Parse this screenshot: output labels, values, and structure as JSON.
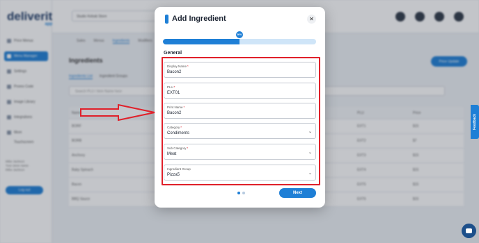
{
  "app": {
    "logo": "deliverit",
    "logo_sub": "app"
  },
  "sidebar": {
    "items": [
      {
        "label": "Price Menus",
        "icon": "menu-icon"
      },
      {
        "label": "Menu Manager",
        "icon": "list-icon",
        "active": true
      },
      {
        "label": "Settings",
        "icon": "gear-icon"
      },
      {
        "label": "Promo Code",
        "icon": "tag-icon"
      },
      {
        "label": "Image Library",
        "icon": "image-icon"
      },
      {
        "label": "Integrations",
        "icon": "plug-icon"
      },
      {
        "label": "More",
        "icon": "dots-icon"
      },
      {
        "label": "Touchscreen",
        "icon": "screen-icon"
      }
    ],
    "user_lines": [
      "Mike Jackson",
      "Your store name",
      "Mike Jackson"
    ],
    "action_button": "Log out"
  },
  "topbar": {
    "store": "Studio Kebab Store"
  },
  "tabs": [
    "Sales",
    "Menus",
    "Ingredients",
    "Modifiers"
  ],
  "page": {
    "title": "Ingredients",
    "update_button": "Price Update",
    "subtabs": [
      "Ingredients List",
      "Ingredient Groups"
    ],
    "search_placeholder": "Search PLU / Item Name here"
  },
  "table": {
    "headers": [
      "Name",
      "PLU",
      "Price"
    ],
    "rows": [
      [
        "BORF",
        "EXT1",
        "$15"
      ],
      [
        "BORB",
        "EXT2",
        "$7"
      ],
      [
        "Anchovy",
        "EXT3",
        "$15"
      ],
      [
        "Baby Spinach",
        "EXT4",
        "$15"
      ],
      [
        "Bacon",
        "EXT5",
        "$15"
      ],
      [
        "BBQ Sauce",
        "EXT6",
        "$15"
      ]
    ]
  },
  "feedback_tab": "Feedback",
  "modal": {
    "title": "Add Ingredient",
    "close_icon": "close-icon",
    "progress_percent": 50,
    "progress_label": "50%",
    "section": "General",
    "fields": [
      {
        "label": "Display Name",
        "required": "*",
        "value": "Bacon2"
      },
      {
        "label": "PLU",
        "required": "*",
        "value": "EXT01"
      },
      {
        "label": "Print Name",
        "required": "*",
        "value": "Bacon2"
      },
      {
        "label": "Category",
        "required": "*",
        "value": "Condiments",
        "dropdown": true
      },
      {
        "label": "Sub Category",
        "required": "*",
        "value": "Meat",
        "dropdown": true
      },
      {
        "label": "Ingredient Group",
        "required": "",
        "value": "Pizza5",
        "dropdown": true
      }
    ],
    "next_button": "Next"
  },
  "colors": {
    "accent": "#1e7fd6",
    "annotation": "#e0202a"
  }
}
